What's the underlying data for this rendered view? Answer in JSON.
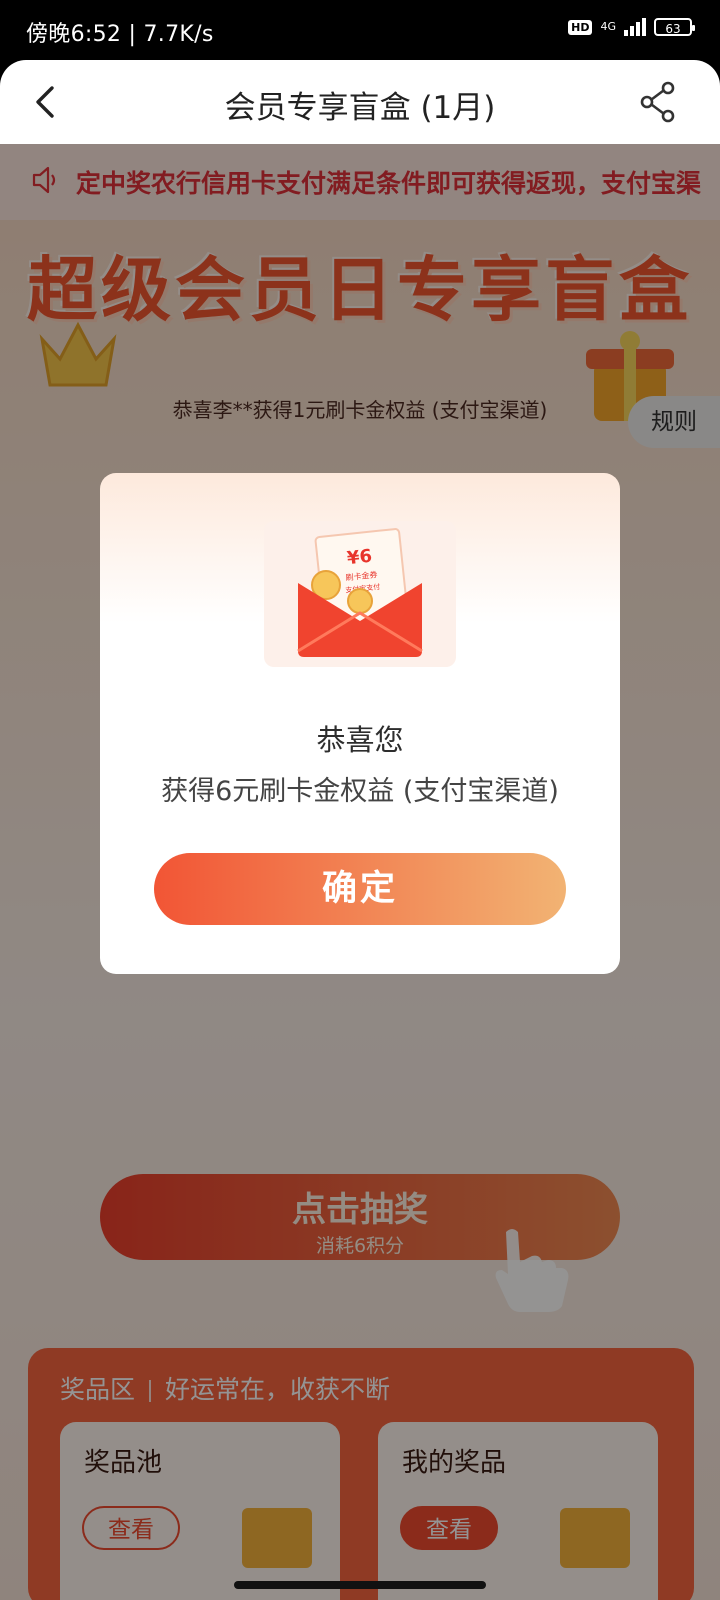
{
  "status_bar": {
    "time_speed": "傍晚6:52 | 7.7K/s",
    "hd": "HD",
    "network": "4G",
    "battery": "63"
  },
  "header": {
    "title": "会员专享盲盒 (1月)"
  },
  "notice": {
    "text": "定中奖农行信用卡支付满足条件即可获得返现，支付宝渠"
  },
  "banner": {
    "title": "超级会员日专享盲盒"
  },
  "winner_ticker": "恭喜李**获得1元刷卡金权益 (支付宝渠道)",
  "rules_label": "规则",
  "draw": {
    "label": "点击抽奖",
    "sub_label": "消耗6积分"
  },
  "prize_area": {
    "title": "奖品区",
    "slogan": "好运常在，收获不断",
    "cards": [
      {
        "title": "奖品池",
        "button": "查看"
      },
      {
        "title": "我的奖品",
        "button": "查看"
      }
    ]
  },
  "modal": {
    "image": {
      "amount": "¥6",
      "line1": "刷卡金券",
      "line2": "支付宝支付"
    },
    "title": "恭喜您",
    "message": "获得6元刷卡金权益 (支付宝渠道)",
    "confirm_label": "确定"
  },
  "colors": {
    "accent_red": "#f04a30",
    "gradient_start": "#f25535",
    "gradient_end": "#f2b373"
  }
}
